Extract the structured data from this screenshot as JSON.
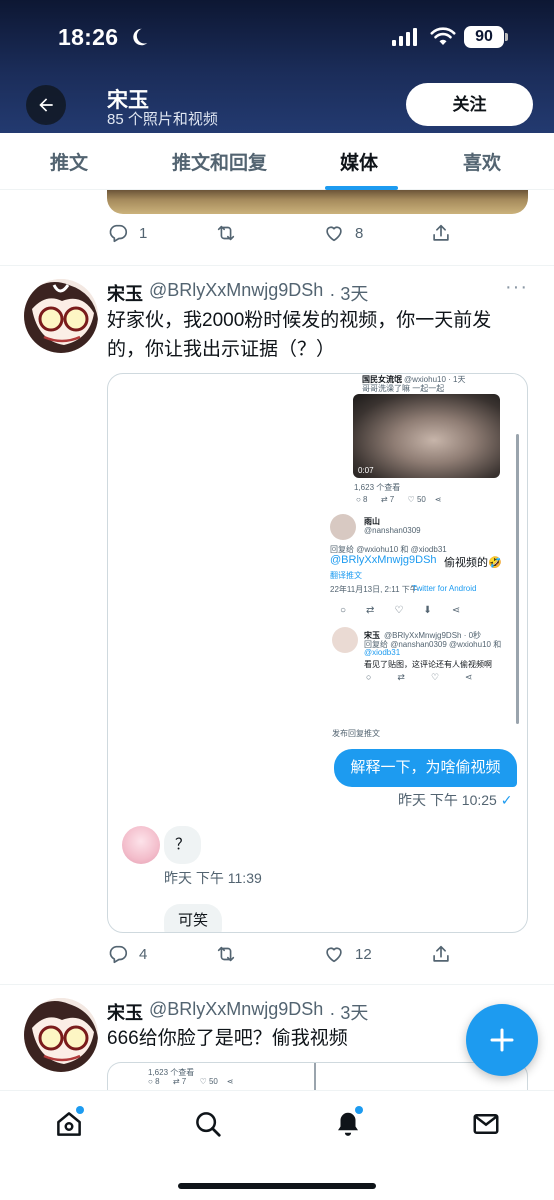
{
  "status_bar": {
    "time": "18:26",
    "battery": "90"
  },
  "profile": {
    "name": "宋玉",
    "media_count": "85 个照片和视频",
    "follow_label": "关注"
  },
  "tabs": [
    {
      "label": "推文"
    },
    {
      "label": "推文和回复"
    },
    {
      "label": "媒体"
    },
    {
      "label": "喜欢"
    }
  ],
  "prev_tweet": {
    "replies": "1",
    "likes": "8"
  },
  "tweet1": {
    "name": "宋玉",
    "handle": "@BRlyXxMnwjg9DSh",
    "time": "· 3天",
    "more": "···",
    "text": "好家伙，我2000粉时候发的视频，你一天前发的，你让我出示证据（？）",
    "replies": "4",
    "likes": "12",
    "screenshot": {
      "a_name": "国民女流氓",
      "a_handle": "@wxiohu10 · 1天",
      "a_text": "哥哥洗澡了嘛 一起一起",
      "a_views": "1,623 个查看",
      "a_video_time": "0:07",
      "a_rt": "7",
      "a_likes": "50",
      "b_name": "雨山",
      "b_handle": "@nanshan0309",
      "b_replying": "回复给 @wxiohu10 和 @xiodb31",
      "b_text_handle": "@BRlyXxMnwjg9DSh",
      "b_text": "偷视频的🤣",
      "b_translate": "翻译推文",
      "b_date": "22年11月13日, 2:11 下午 ·",
      "b_source": "Twitter for Android",
      "c_name": "宋玉",
      "c_handle": "@BRlyXxMnwjg9DSh · 0秒",
      "c_replying": "回复给 @nanshan0309 @wxiohu10 和",
      "c_replying2": "@xiodb31",
      "c_text": "看见了贴图，这评论还有人偷视频啊",
      "reply_prompt": "发布回复推文"
    },
    "chat": {
      "blue_message": "解释一下，为啥偷视频",
      "blue_time": "昨天 下午 10:25",
      "grey_message": "？",
      "grey_time": "昨天 下午 11:39",
      "grey_message2": "可笑"
    }
  },
  "tweet2": {
    "name": "宋玉",
    "handle": "@BRlyXxMnwjg9DSh",
    "time": "· 3天",
    "text": "666给你脸了是吧？偷我视频",
    "preview_views": "1,623 个查看",
    "preview_replies": "8",
    "preview_rt": "7",
    "preview_likes": "50"
  },
  "colors": {
    "accent": "#1d9bf0",
    "header_bg": "#1b2d5a",
    "text_secondary": "#536471"
  },
  "icons": [
    "back-arrow-icon",
    "moon-icon",
    "wifi-icon",
    "reply-icon",
    "retweet-icon",
    "like-icon",
    "share-icon",
    "compose-plus-icon",
    "home-icon",
    "search-icon",
    "bell-icon",
    "mail-icon"
  ]
}
